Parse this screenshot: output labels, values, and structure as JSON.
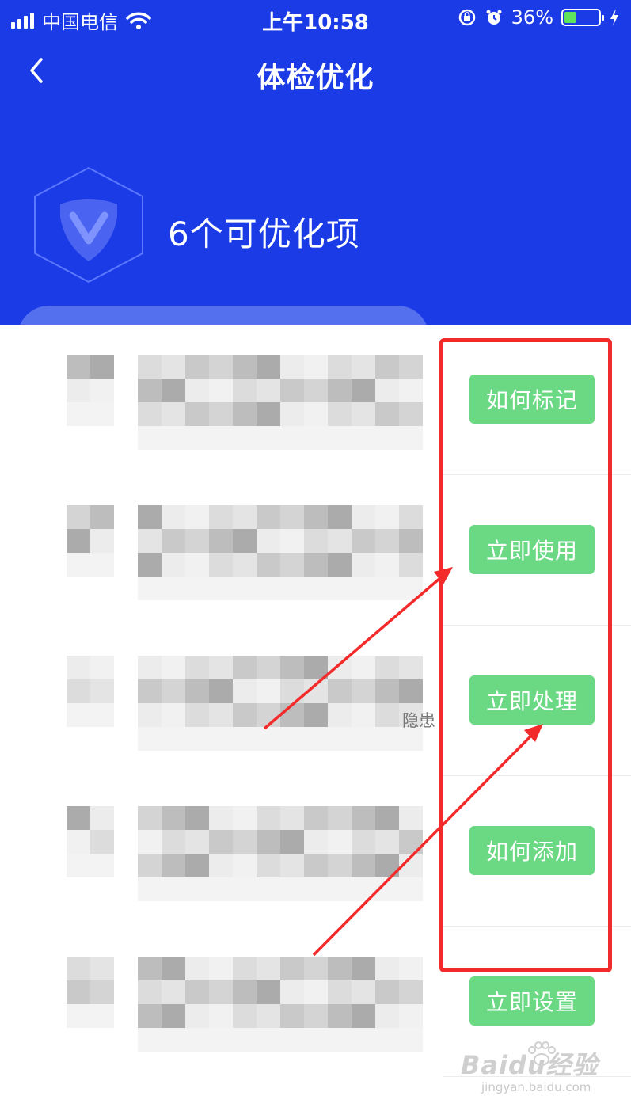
{
  "status_bar": {
    "carrier": "中国电信",
    "time": "上午10:58",
    "battery": "36%",
    "battery_level": 0.36
  },
  "nav": {
    "title": "体检优化"
  },
  "summary": {
    "count_text": "6个可优化项"
  },
  "rows": [
    {
      "action": "如何标记"
    },
    {
      "action": "立即使用"
    },
    {
      "action": "立即处理"
    },
    {
      "action": "如何添加"
    },
    {
      "action": "立即设置"
    }
  ],
  "partial_text": "隐患",
  "watermark": {
    "brand": "Baidu经验",
    "url": "jingyan.baidu.com"
  },
  "colors": {
    "header_blue": "#1a3be6",
    "button_green": "#6bd884",
    "highlight_red": "#f22a2a"
  }
}
